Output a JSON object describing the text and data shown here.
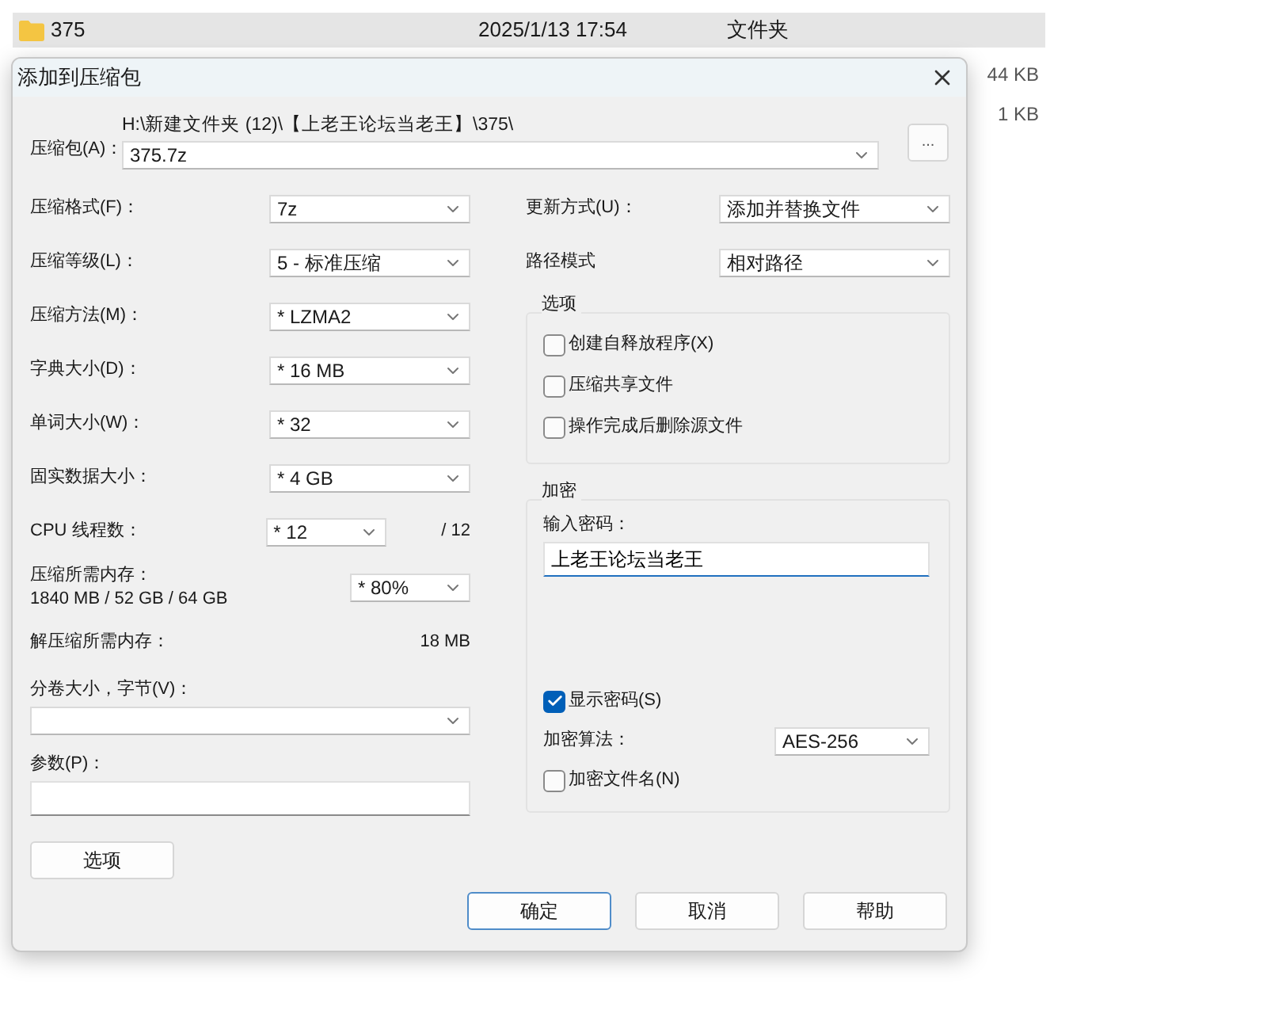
{
  "explorer": {
    "folder_row": {
      "name": "375",
      "modified": "2025/1/13 17:54",
      "type": "文件夹",
      "selected": true
    },
    "sizes": [
      "44 KB",
      "1 KB"
    ]
  },
  "window": {
    "title": "添加到压缩包"
  },
  "archive": {
    "label": "压缩包(A)：",
    "path": "H:\\新建文件夹 (12)\\【上老王论坛当老王】\\375\\",
    "value": "375.7z",
    "browse": "..."
  },
  "left_fields": [
    {
      "kind": "combo",
      "label": "压缩格式(F)：",
      "value": "7z"
    },
    {
      "kind": "combo",
      "label": "压缩等级(L)：",
      "value": "5 - 标准压缩"
    },
    {
      "kind": "combo",
      "label": "压缩方法(M)：",
      "value": "* LZMA2"
    },
    {
      "kind": "combo",
      "label": "字典大小(D)：",
      "value": "* 16 MB"
    },
    {
      "kind": "combo",
      "label": "单词大小(W)：",
      "value": "* 32"
    },
    {
      "kind": "combo",
      "label": "固实数据大小：",
      "value": "* 4 GB"
    },
    {
      "kind": "short",
      "label": "CPU 线程数：",
      "value": "* 12",
      "suffix": "/ 12"
    },
    {
      "kind": "memory",
      "label": "压缩所需内存：",
      "detail": "1840 MB / 52 GB / 64 GB",
      "value": "* 80%"
    },
    {
      "kind": "reading",
      "label": "解压缩所需内存：",
      "value": "18 MB"
    }
  ],
  "split": {
    "label": "分卷大小，字节(V)："
  },
  "params": {
    "label": "参数(P)："
  },
  "options_button": "选项",
  "right_fields": [
    {
      "label": "更新方式(U)：",
      "value": "添加并替换文件"
    },
    {
      "label": "路径模式",
      "value": "相对路径"
    }
  ],
  "options_group": {
    "title": "选项",
    "checkboxes": [
      {
        "label": "创建自释放程序(X)",
        "checked": false
      },
      {
        "label": "压缩共享文件",
        "checked": false
      },
      {
        "label": "操作完成后删除源文件",
        "checked": false
      }
    ]
  },
  "encryption": {
    "title": "加密",
    "password_label": "输入密码：",
    "password": "上老王论坛当老王",
    "show_password": {
      "label": "显示密码(S)",
      "checked": true
    },
    "method": {
      "label": "加密算法：",
      "value": "AES-256"
    },
    "encrypt_names": {
      "label": "加密文件名(N)",
      "checked": false
    }
  },
  "buttons": [
    {
      "label": "确定",
      "default": true
    },
    {
      "label": "取消",
      "default": false
    },
    {
      "label": "帮助",
      "default": false
    }
  ]
}
